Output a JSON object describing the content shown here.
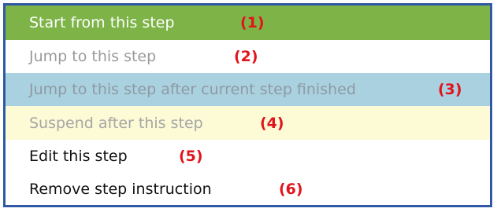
{
  "context_menu": {
    "items": [
      {
        "label": "Start from this step",
        "number": "(1)",
        "state": "highlighted"
      },
      {
        "label": "Jump to this step",
        "number": "(2)",
        "state": "disabled"
      },
      {
        "label": "Jump to this step after current step finished",
        "number": "(3)",
        "state": "disabled"
      },
      {
        "label": "Suspend after this step",
        "number": "(4)",
        "state": "disabled"
      },
      {
        "label": "Edit this step",
        "number": "(5)",
        "state": "enabled"
      },
      {
        "label": "Remove step instruction",
        "number": "(6)",
        "state": "enabled"
      }
    ],
    "colors": {
      "border": "#2f59a7",
      "highlight": "#7db347",
      "row3_background": "#a9d1e0",
      "row4_background": "#fcfbd6",
      "annotation": "#e1141c"
    }
  }
}
